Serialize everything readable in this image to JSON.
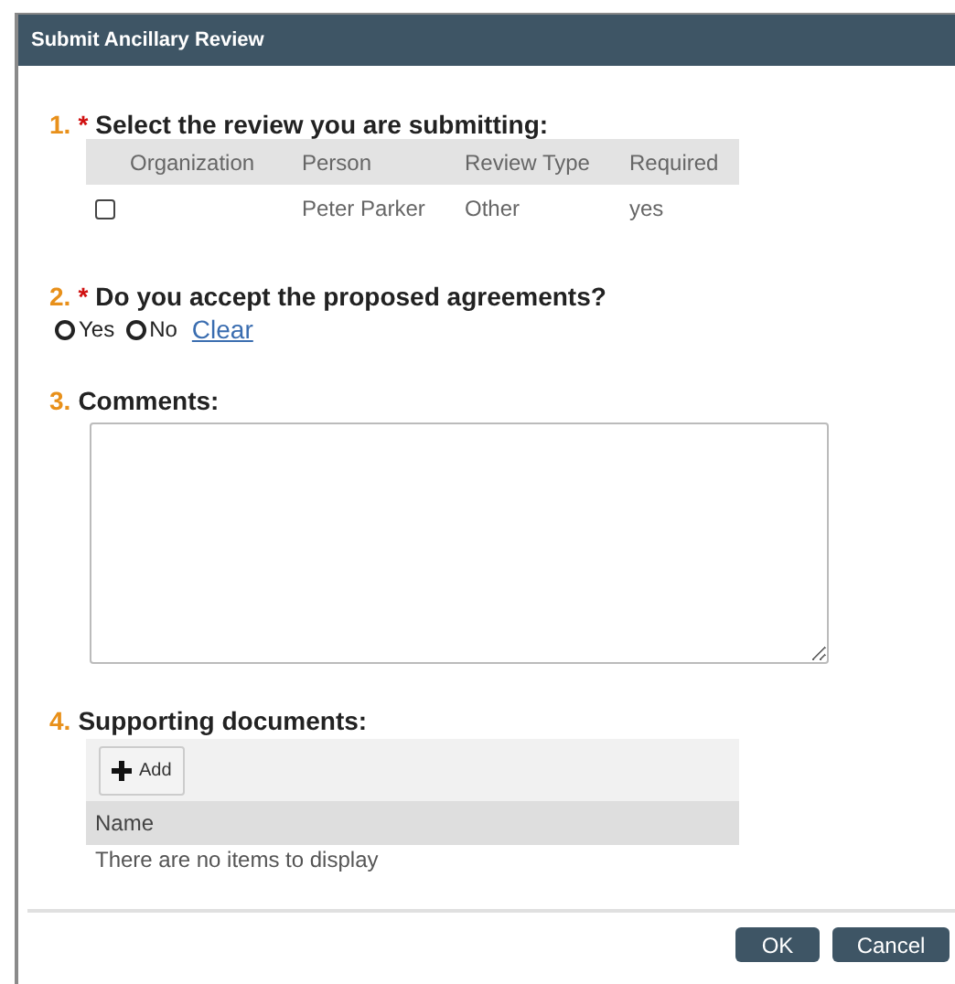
{
  "window": {
    "title": "Submit Ancillary Review"
  },
  "questions": [
    {
      "kind": "table",
      "number": "1.",
      "required": true,
      "required_mark": "*",
      "label": "Select the review you are submitting:",
      "columns": [
        "Organization",
        "Person",
        "Review Type",
        "Required"
      ],
      "rows": [
        {
          "checked": false,
          "cells": [
            "",
            "Peter Parker",
            "Other",
            "yes"
          ]
        }
      ]
    },
    {
      "kind": "radio",
      "number": "2.",
      "required": true,
      "required_mark": "*",
      "label": "Do you accept the proposed agreements?",
      "options": [
        {
          "label": "Yes",
          "selected": false
        },
        {
          "label": "No",
          "selected": false
        }
      ],
      "clear_link": "Clear"
    },
    {
      "kind": "textarea",
      "number": "3.",
      "required": false,
      "label": "Comments:"
    },
    {
      "kind": "documents",
      "number": "4.",
      "required": false,
      "label": "Supporting documents:",
      "add_button": "Add",
      "columns": [
        "Name"
      ],
      "empty_text": "There are no items to display"
    }
  ],
  "buttons": [
    "OK",
    "Cancel"
  ]
}
